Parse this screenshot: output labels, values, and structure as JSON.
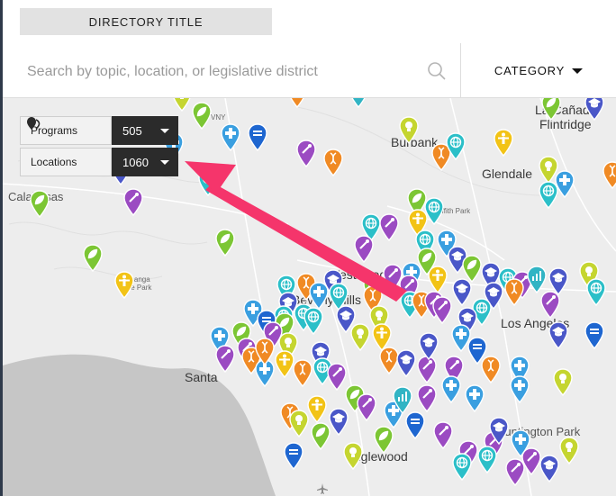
{
  "header": {
    "title": "DIRECTORY TITLE"
  },
  "search": {
    "placeholder": "Search by topic, location, or legislative district"
  },
  "category": {
    "label": "CATEGORY"
  },
  "stats": {
    "programs": {
      "label": "Programs",
      "value": "505"
    },
    "locations": {
      "label": "Locations",
      "value": "1060"
    }
  },
  "map": {
    "places": [
      "VNY",
      "Burbank",
      "La Cañada",
      "Flintridge",
      "Glendale",
      "Griffith Park",
      "Calabasas",
      "Topanga",
      "State Park",
      "Westwood",
      "Beverly Hills",
      "Santa",
      "Los Angeles",
      "Huntington Park",
      "Inglewood"
    ],
    "pins": [
      {
        "cat": "leaf",
        "color": "#7cc634"
      },
      {
        "cat": "bulb",
        "color": "#c5d530"
      },
      {
        "cat": "dna",
        "color": "#f08a24"
      },
      {
        "cat": "chart",
        "color": "#31b4c4"
      },
      {
        "cat": "health",
        "color": "#3a9fe0"
      },
      {
        "cat": "justice",
        "color": "#1e66d0"
      },
      {
        "cat": "grad",
        "color": "#4a57c8"
      },
      {
        "cat": "care",
        "color": "#f2c316"
      },
      {
        "cat": "globe",
        "color": "#2bbfc8"
      },
      {
        "cat": "tool",
        "color": "#9b4bc2"
      }
    ],
    "annotation": {
      "color": "#f5356b",
      "kind": "arrow"
    }
  }
}
